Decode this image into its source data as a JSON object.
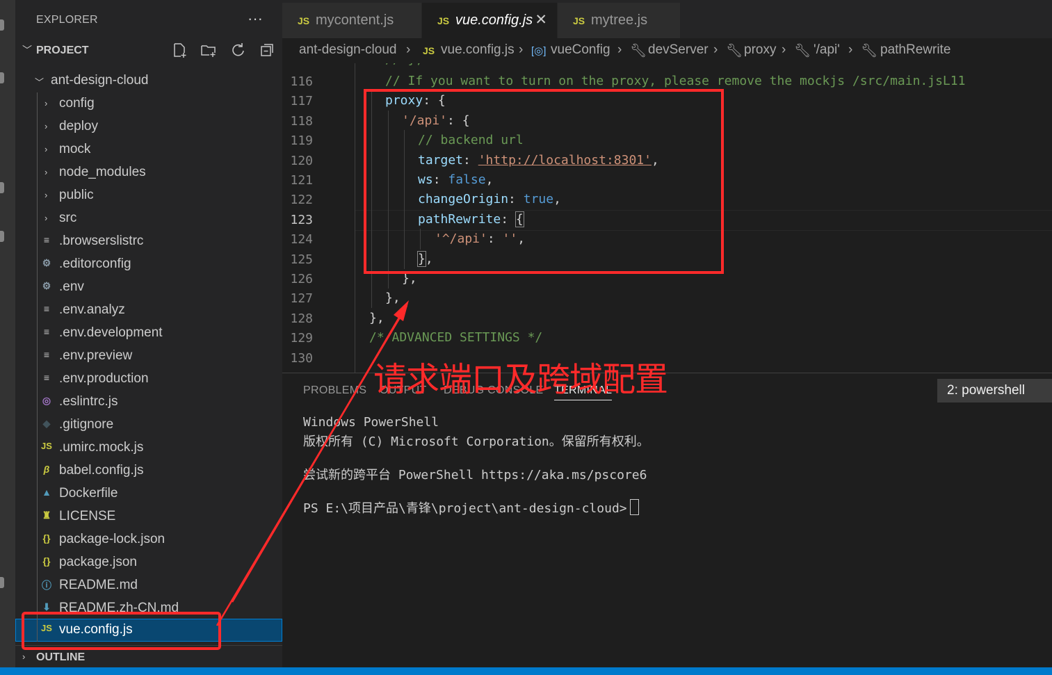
{
  "explorer": {
    "title": "EXPLORER",
    "more": "···",
    "project_label": "PROJECT",
    "root_folder": "ant-design-cloud",
    "items": [
      {
        "name": "config",
        "type": "folder"
      },
      {
        "name": "deploy",
        "type": "folder"
      },
      {
        "name": "mock",
        "type": "folder"
      },
      {
        "name": "node_modules",
        "type": "folder"
      },
      {
        "name": "public",
        "type": "folder"
      },
      {
        "name": "src",
        "type": "folder"
      },
      {
        "name": ".browserslistrc",
        "type": "file"
      },
      {
        "name": ".editorconfig",
        "type": "file"
      },
      {
        "name": ".env",
        "type": "file"
      },
      {
        "name": ".env.analyz",
        "type": "file"
      },
      {
        "name": ".env.development",
        "type": "file"
      },
      {
        "name": ".env.preview",
        "type": "file"
      },
      {
        "name": ".env.production",
        "type": "file"
      },
      {
        "name": ".eslintrc.js",
        "type": "file"
      },
      {
        "name": ".gitignore",
        "type": "file"
      },
      {
        "name": ".umirc.mock.js",
        "type": "file"
      },
      {
        "name": "babel.config.js",
        "type": "file"
      },
      {
        "name": "Dockerfile",
        "type": "file"
      },
      {
        "name": "LICENSE",
        "type": "file"
      },
      {
        "name": "package-lock.json",
        "type": "file"
      },
      {
        "name": "package.json",
        "type": "file"
      },
      {
        "name": "README.md",
        "type": "file"
      },
      {
        "name": "README.zh-CN.md",
        "type": "file"
      },
      {
        "name": "vue.config.js",
        "type": "file"
      }
    ],
    "outline_label": "OUTLINE"
  },
  "tabs": [
    {
      "icon": "JS",
      "label": "mycontent.js"
    },
    {
      "icon": "JS",
      "label": "vue.config.js",
      "close": "✕"
    },
    {
      "icon": "JS",
      "label": "mytree.js"
    }
  ],
  "breadcrumbs": {
    "folder": "ant-design-cloud",
    "file_icon": "JS",
    "file": "vue.config.js",
    "var_icon": "[◎]",
    "var": "vueConfig",
    "prop1": "devServer",
    "prop2": "proxy",
    "prop3": "'/api'",
    "prop4": "pathRewrite"
  },
  "editor": {
    "line_numbers": [
      "116",
      "117",
      "118",
      "119",
      "120",
      "121",
      "122",
      "123",
      "124",
      "125",
      "126",
      "127",
      "128",
      "129",
      "130"
    ],
    "comment_116": "// If you want to turn on the proxy, please remove the mockjs /src/main.jsL11",
    "proxy_key": "proxy",
    "api_key": "'/api'",
    "comment_119": "// backend url",
    "target_key": "target",
    "target_val": "'http://localhost:8301'",
    "ws_key": "ws",
    "ws_val": "false",
    "change_key": "changeOrigin",
    "change_val": "true",
    "rewrite_key": "pathRewrite",
    "rewrite_from": "'^/api'",
    "rewrite_to": "''",
    "comment_129": "/* ADVANCED SETTINGS */"
  },
  "panel": {
    "tabs": [
      "PROBLEMS",
      "OUTPUT",
      "DEBUG CONSOLE",
      "TERMINAL"
    ],
    "terminal_selector": "2: powershell",
    "lines": [
      "Windows PowerShell",
      "版权所有 (C) Microsoft Corporation。保留所有权利。",
      "尝试新的跨平台 PowerShell https://aka.ms/pscore6",
      "PS E:\\项目产品\\青锋\\project\\ant-design-cloud>"
    ]
  },
  "annotation": {
    "label": "请求端口及跨域配置",
    "color": "#ff2a2a"
  },
  "colors": {
    "accent": "#007acc",
    "selection": "#094771",
    "js_icon": "#cbcb41"
  }
}
